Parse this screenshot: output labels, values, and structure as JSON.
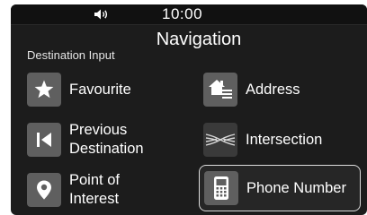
{
  "status": {
    "time": "10:00",
    "volume_icon": "speaker-icon"
  },
  "header": {
    "title": "Navigation",
    "subtitle": "Destination Input"
  },
  "menu": [
    {
      "label": "Favourite",
      "icon": "star-icon"
    },
    {
      "label": "Address",
      "icon": "house-list-icon"
    },
    {
      "label": "Previous\nDestination",
      "icon": "skip-back-icon"
    },
    {
      "label": "Intersection",
      "icon": "crossroads-icon"
    },
    {
      "label": "Point of\nInterest",
      "icon": "map-pin-icon"
    },
    {
      "label": "Phone Number",
      "icon": "phone-icon",
      "selected": true
    }
  ],
  "colors": {
    "background": "#1c1c1c",
    "icon_tile": "#5f5f5f",
    "text": "#ffffff",
    "selection_border": "#dcdcdc"
  }
}
